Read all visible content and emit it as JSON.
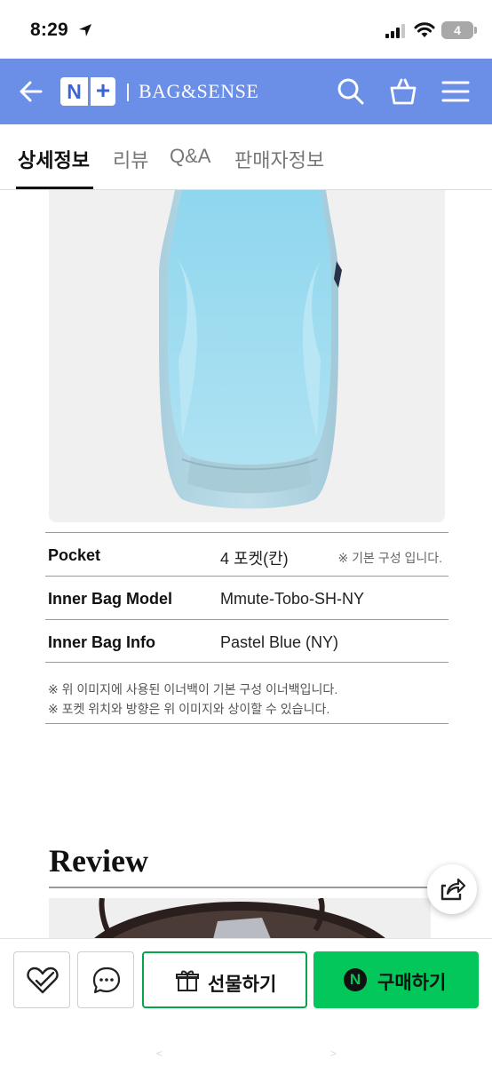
{
  "status_bar": {
    "time": "8:29",
    "battery": "4"
  },
  "header": {
    "logo_n": "N",
    "logo_plus": "+",
    "brand": "BAG&SENSE",
    "color": "#6b8ee6"
  },
  "tabs": [
    "상세정보",
    "리뷰",
    "Q&A",
    "판매자정보"
  ],
  "specs": [
    {
      "label": "Pocket",
      "value": "4 포켓(칸)",
      "note": "※ 기본 구성 입니다."
    },
    {
      "label": "Inner Bag Model",
      "value": "Mmute-Tobo-SH-NY"
    },
    {
      "label": "Inner Bag Info",
      "value": "Pastel Blue (NY)"
    }
  ],
  "notes": [
    "※ 위 이미지에 사용된 이너백이 기본 구성 이너백입니다.",
    "※ 포켓 위치와 방향은 위 이미지와 상이할 수 있습니다."
  ],
  "review": {
    "title": "Review"
  },
  "bottom_bar": {
    "gift_label": "선물하기",
    "buy_label": "구매하기",
    "npay_badge": "N",
    "buy_color": "#03c75a",
    "nav_prev": "<",
    "nav_next": ">"
  },
  "icons": [
    "location-arrow-icon",
    "signal-icon",
    "wifi-icon",
    "back-arrow-icon",
    "search-icon",
    "shopping-bag-icon",
    "hamburger-menu-icon",
    "share-icon",
    "heart-check-icon",
    "chat-bubble-icon",
    "gift-icon"
  ]
}
